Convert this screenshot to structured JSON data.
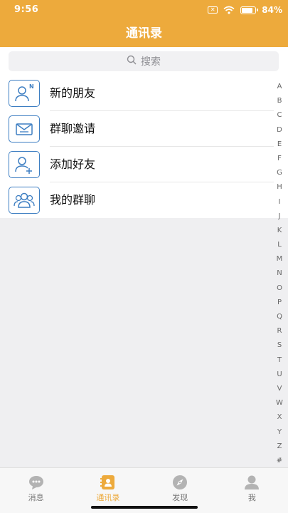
{
  "status_bar": {
    "time": "9:56",
    "battery": "84%",
    "battery_level": 0.84,
    "x_badge": "✕"
  },
  "header": {
    "title": "通讯录"
  },
  "search": {
    "placeholder": "搜索"
  },
  "menu": [
    {
      "label": "新的朋友",
      "icon": "new-friend-icon",
      "badge": "N"
    },
    {
      "label": "群聊邀请",
      "icon": "group-invite-icon"
    },
    {
      "label": "添加好友",
      "icon": "add-friend-icon"
    },
    {
      "label": "我的群聊",
      "icon": "my-groups-icon"
    }
  ],
  "index_letters": [
    "A",
    "B",
    "C",
    "D",
    "E",
    "F",
    "G",
    "H",
    "I",
    "J",
    "K",
    "L",
    "M",
    "N",
    "O",
    "P",
    "Q",
    "R",
    "S",
    "T",
    "U",
    "V",
    "W",
    "X",
    "Y",
    "Z",
    "#"
  ],
  "tabs": [
    {
      "label": "消息",
      "icon": "chat-icon",
      "active": false
    },
    {
      "label": "通讯录",
      "icon": "contacts-icon",
      "active": true
    },
    {
      "label": "发现",
      "icon": "compass-icon",
      "active": false
    },
    {
      "label": "我",
      "icon": "profile-icon",
      "active": false
    }
  ],
  "colors": {
    "accent": "#edaa3c",
    "icon_blue": "#3d7ec2",
    "tab_inactive": "#b3b3b3"
  }
}
